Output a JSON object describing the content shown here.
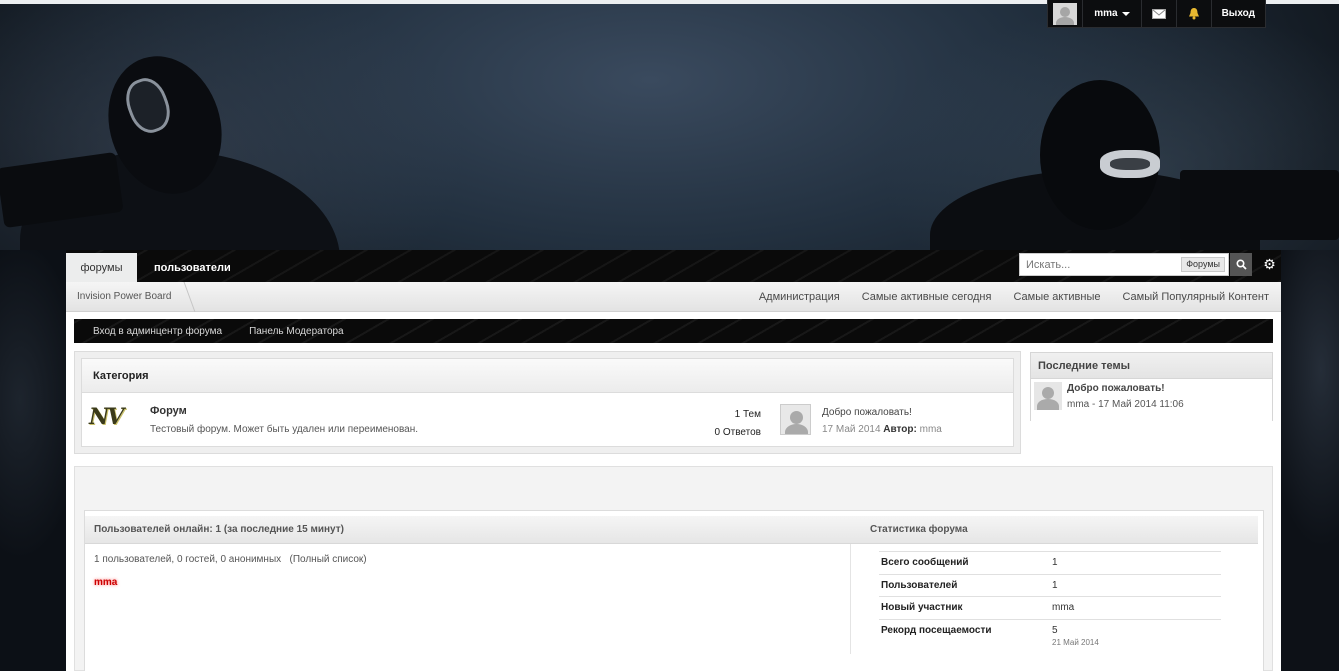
{
  "userbar": {
    "username": "mma",
    "logout_label": "Выход"
  },
  "nav": {
    "tabs": [
      {
        "label": "форумы"
      },
      {
        "label": "пользователи"
      }
    ],
    "search_placeholder": "Искать...",
    "search_scope": "Форумы"
  },
  "breadcrumb": {
    "root": "Invision Power Board"
  },
  "sublinks": [
    "Администрация",
    "Самые активные сегодня",
    "Самые активные",
    "Самый Популярный Контент"
  ],
  "modbar": {
    "admin_link": "Вход в админцентр форума",
    "mod_link": "Панель Модератора"
  },
  "category": {
    "title": "Категория",
    "forum": {
      "logo_text": "NV",
      "name": "Форум",
      "description": "Тестовый форум. Может быть удален или переименован.",
      "topics": "1 Тем",
      "replies": "0 Ответов",
      "last_post_title": "Добро пожаловать!",
      "last_post_date": "17 Май 2014",
      "last_post_author_label": "Автор:",
      "last_post_author": "mma"
    }
  },
  "recent_topics": {
    "title": "Последние темы",
    "items": [
      {
        "title": "Добро пожаловать!",
        "meta": "mma - 17 Май 2014 11:06"
      }
    ]
  },
  "online": {
    "title": "Пользователей онлайн: 1 (за последние 15 минут)",
    "summary": "1 пользователей, 0 гостей, 0 анонимных",
    "full_list": "(Полный список)",
    "users": [
      "mma"
    ]
  },
  "stats": {
    "title": "Статистика форума",
    "rows": [
      {
        "label": "Всего сообщений",
        "value": "1"
      },
      {
        "label": "Пользователей",
        "value": "1"
      },
      {
        "label": "Новый участник",
        "value": "mma"
      },
      {
        "label": "Рекорд посещаемости",
        "value": "5",
        "sub": "21 Май 2014"
      }
    ]
  }
}
